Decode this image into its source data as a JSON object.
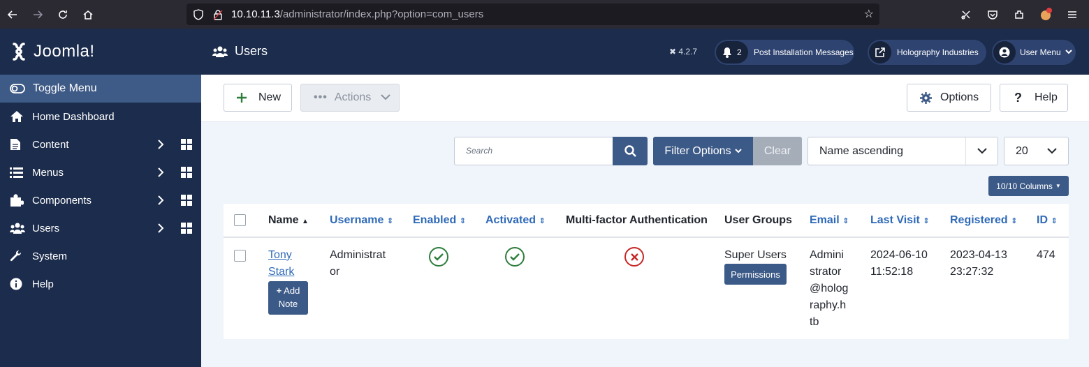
{
  "browser": {
    "url_host": "10.10.11.3",
    "url_path": "/administrator/index.php?option=com_users"
  },
  "sidebar": {
    "logo_text": "Joomla!",
    "toggle_label": "Toggle Menu",
    "items": [
      {
        "label": "Home Dashboard",
        "icon": "home-icon"
      },
      {
        "label": "Content",
        "icon": "file-icon"
      },
      {
        "label": "Menus",
        "icon": "list-icon"
      },
      {
        "label": "Components",
        "icon": "puzzle-icon"
      },
      {
        "label": "Users",
        "icon": "users-icon"
      },
      {
        "label": "System",
        "icon": "wrench-icon"
      },
      {
        "label": "Help",
        "icon": "info-icon"
      }
    ]
  },
  "header": {
    "title": "Users",
    "version": "4.2.7",
    "notifications_count": "2",
    "post_install_label": "Post Installation Messages",
    "site_label": "Holography Industries",
    "user_menu_label": "User Menu"
  },
  "toolbar": {
    "new_label": "New",
    "actions_label": "Actions",
    "options_label": "Options",
    "help_label": "Help"
  },
  "filters": {
    "search_placeholder": "Search",
    "filter_options_label": "Filter Options",
    "clear_label": "Clear",
    "sort_value": "Name ascending",
    "limit_value": "20",
    "columns_label": "10/10 Columns"
  },
  "table": {
    "headers": {
      "name": "Name",
      "username": "Username",
      "enabled": "Enabled",
      "activated": "Activated",
      "mfa": "Multi-factor Authentication",
      "groups": "User Groups",
      "email": "Email",
      "last_visit": "Last Visit",
      "registered": "Registered",
      "id": "ID"
    },
    "rows": [
      {
        "name_line1": "Tony",
        "name_line2": "Stark",
        "add_note_line1": "Add",
        "add_note_line2": "Note",
        "username_line1": "Administrat",
        "username_line2": "or",
        "enabled": true,
        "activated": true,
        "mfa": false,
        "groups": "Super Users",
        "permissions_label": "Permissions",
        "email_lines": [
          "Admini",
          "strator",
          "@holog",
          "raphy.h",
          "tb"
        ],
        "last_visit_line1": "2024-06-10",
        "last_visit_line2": "11:52:18",
        "registered_line1": "2023-04-13",
        "registered_line2": "23:27:32",
        "id": "474"
      }
    ]
  },
  "colors": {
    "sidebar_bg": "#1c2c4c",
    "accent": "#3c5a87",
    "link": "#2f6ab8",
    "success": "#2f7d3c",
    "danger": "#c52827"
  }
}
